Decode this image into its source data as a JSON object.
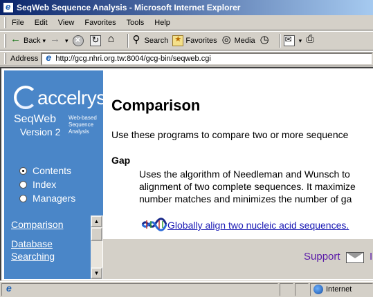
{
  "window": {
    "title": "SeqWeb Sequence Analysis - Microsoft Internet Explorer"
  },
  "menubar": {
    "items": [
      "File",
      "Edit",
      "View",
      "Favorites",
      "Tools",
      "Help"
    ]
  },
  "toolbar": {
    "back_label": "Back",
    "search_label": "Search",
    "favorites_label": "Favorites",
    "media_label": "Media"
  },
  "address": {
    "label": "Address",
    "url": "http://gcg.nhri.org.tw:8004/gcg-bin/seqweb.cgi"
  },
  "sidebar": {
    "logo": "accelrys",
    "product": "SeqWeb",
    "version": "Version 2",
    "tagline": [
      "Web-based",
      "Sequence",
      "Analysis"
    ],
    "radios": [
      {
        "label": "Contents",
        "selected": true
      },
      {
        "label": "Index",
        "selected": false
      },
      {
        "label": "Managers",
        "selected": false
      }
    ],
    "links": [
      "Comparison",
      "Database",
      "Searching"
    ]
  },
  "content": {
    "title": "Comparison",
    "intro": "Use these programs to compare two or more sequence",
    "program": {
      "name": "Gap",
      "description": [
        "Uses the algorithm of Needleman and Wunsch to",
        "alignment of two complete sequences. It maximize",
        "number matches and minimizes the number of ga"
      ],
      "link": "Globally align two nucleic acid sequences."
    }
  },
  "footer": {
    "support": "Support",
    "more": "I"
  },
  "statusbar": {
    "zone": "Internet"
  }
}
